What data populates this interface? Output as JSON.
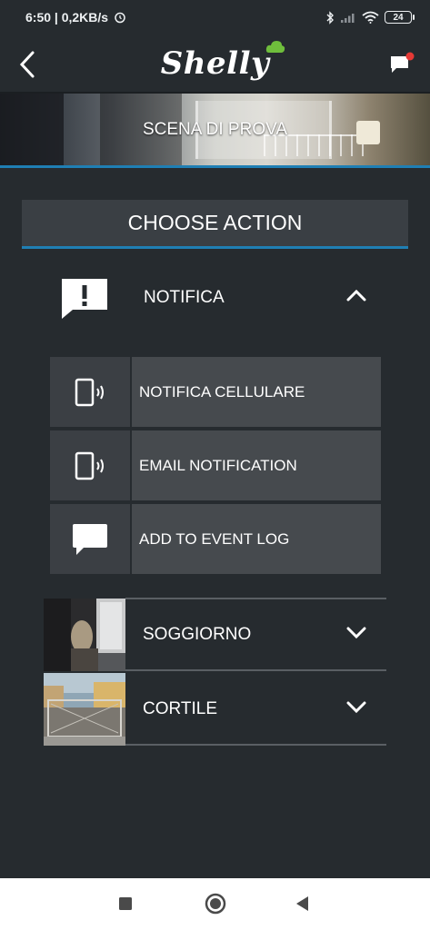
{
  "status_bar": {
    "time_speed": "6:50 | 0,2KB/s",
    "battery": "24"
  },
  "header": {
    "logo_text": "Shelly",
    "brand_color": "#6fbe3c"
  },
  "banner": {
    "title": "SCENA DI PROVA"
  },
  "choose_action": {
    "title": "CHOOSE ACTION"
  },
  "notifica": {
    "label": "NOTIFICA",
    "expanded": true,
    "actions": [
      {
        "label": "NOTIFICA CELLULARE",
        "icon": "phone-signal-icon"
      },
      {
        "label": "EMAIL NOTIFICATION",
        "icon": "phone-signal-icon"
      },
      {
        "label": "ADD TO EVENT LOG",
        "icon": "speech-bubble-icon"
      }
    ]
  },
  "rooms": [
    {
      "name": "SOGGIORNO",
      "expanded": false
    },
    {
      "name": "CORTILE",
      "expanded": false
    }
  ],
  "colors": {
    "background": "#262b2f",
    "accent": "#1f7fb4",
    "notification_dot": "#e53935"
  }
}
